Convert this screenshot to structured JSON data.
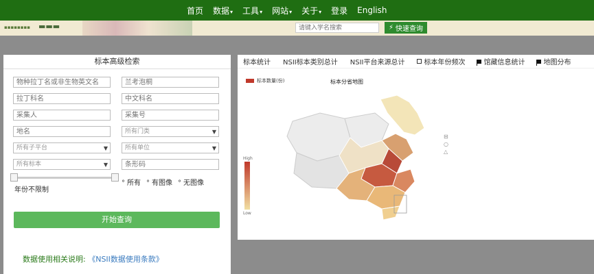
{
  "nav": {
    "items": [
      {
        "label": "首页",
        "dropdown": false
      },
      {
        "label": "数据",
        "dropdown": true
      },
      {
        "label": "工具",
        "dropdown": true
      },
      {
        "label": "网站",
        "dropdown": true
      },
      {
        "label": "关于",
        "dropdown": true
      },
      {
        "label": "登录",
        "dropdown": false
      },
      {
        "label": "English",
        "dropdown": false
      }
    ]
  },
  "banner": {
    "search_placeholder": "请键入学名搜索",
    "search_button": "快速查询"
  },
  "left_panel": {
    "title": "标本高级检索",
    "fields": {
      "species_name": "物种拉丁名或非生物英文名",
      "reference_code": "兰考泡桐",
      "latin_family": "拉丁科名",
      "chinese_family": "中文科名",
      "collector": "采集人",
      "collection_number": "采集号",
      "place": "地名",
      "barcode": "条形码"
    },
    "selects": {
      "department": "所有门类",
      "sub_platform": "所有子平台",
      "unit": "所有单位",
      "specimen": "所有标本"
    },
    "year_label": "年份不限制",
    "image_options": [
      "所有",
      "有图像",
      "无图像"
    ],
    "submit": "开始查询",
    "note_label": "数据使用相关说明:",
    "note_link": "《NSII数据使用条款》"
  },
  "right_panel": {
    "tabs": [
      {
        "label": "标本统计",
        "icon": ""
      },
      {
        "label": "NSII标本类别总计",
        "icon": ""
      },
      {
        "label": "NSII平台来源总计",
        "icon": ""
      },
      {
        "label": "标本年份频次",
        "icon": "calendar-icon"
      },
      {
        "label": "馆藏信息统计",
        "icon": "flag-icon"
      },
      {
        "label": "地图分布",
        "icon": "flag-icon"
      }
    ],
    "map_title": "标本分省地图",
    "legend_label": "标本数量(份)",
    "scale_high": "High",
    "scale_low": "Low",
    "accent_high": "#c0392b",
    "accent_low": "#f1dfa2"
  }
}
